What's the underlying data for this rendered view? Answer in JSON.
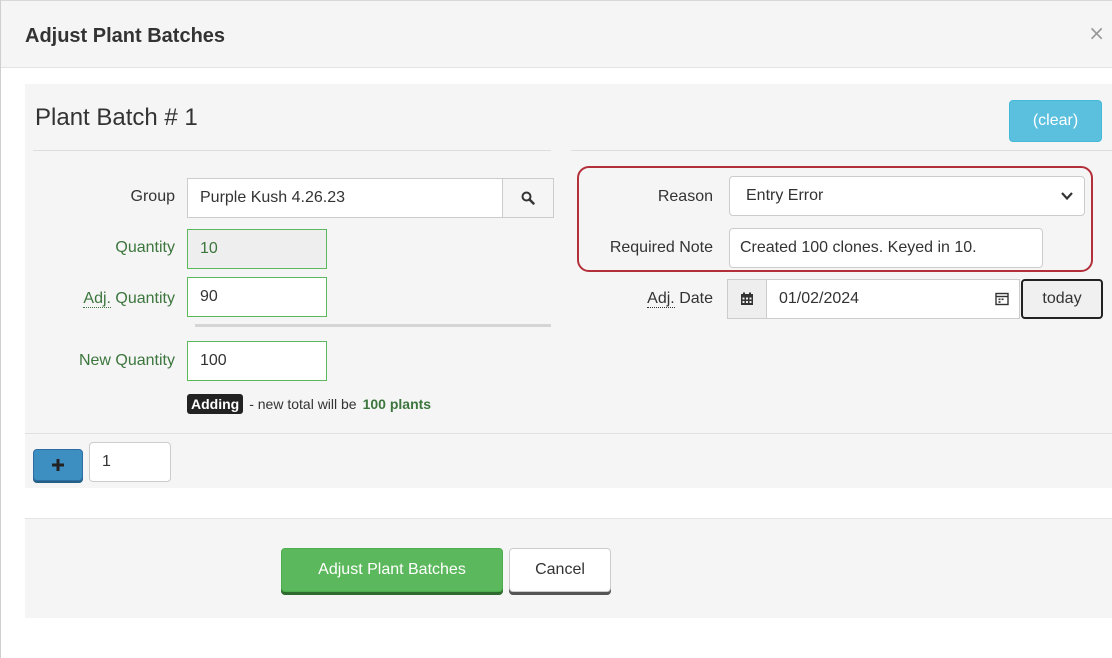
{
  "modal": {
    "title": "Adjust Plant Batches",
    "close_glyph": "×"
  },
  "batch": {
    "title": "Plant Batch # 1",
    "clear_label": "(clear)",
    "group": {
      "label": "Group",
      "value": "Purple Kush 4.26.23"
    },
    "quantity": {
      "label": "Quantity",
      "value": "10"
    },
    "adj_quantity": {
      "label_abbr": "Adj.",
      "label_rest": " Quantity",
      "value": "90"
    },
    "new_quantity": {
      "label": "New Quantity",
      "value": "100"
    },
    "status": {
      "badge": "Adding",
      "text": "- new total will be",
      "plants": "100 plants"
    },
    "reason": {
      "label": "Reason",
      "value": "Entry Error"
    },
    "required_note": {
      "label": "Required Note",
      "value": "Created 100 clones. Keyed in 10."
    },
    "adj_date": {
      "label_abbr": "Adj.",
      "label_rest": " Date",
      "value": "01/02/2024",
      "today_label": "today"
    }
  },
  "add_row": {
    "count": "1"
  },
  "footer": {
    "submit_label": "Adjust Plant Batches",
    "cancel_label": "Cancel"
  },
  "colors": {
    "accent_info": "#5bc0de",
    "success": "#5cb85c",
    "highlight": "#b3303a",
    "primary": "#3d8fc1"
  }
}
